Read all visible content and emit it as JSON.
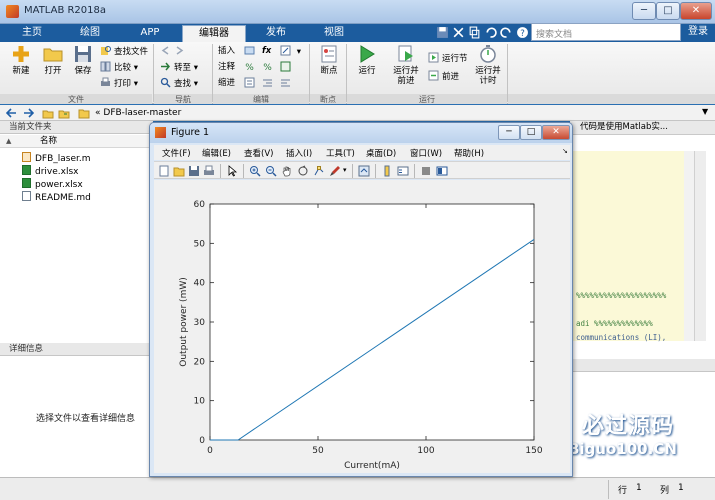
{
  "window": {
    "title": "MATLAB R2018a",
    "minimize": "─",
    "maximize": "□",
    "close": "✕"
  },
  "tabs": [
    {
      "label": "主页"
    },
    {
      "label": "绘图"
    },
    {
      "label": "APP"
    },
    {
      "label": "编辑器",
      "active": true
    },
    {
      "label": "发布"
    },
    {
      "label": "视图"
    }
  ],
  "search": {
    "placeholder": "搜索文档"
  },
  "login_label": "登录",
  "ribbon": {
    "file_group": {
      "label": "文件",
      "new": "新建",
      "open": "打开",
      "save": "保存",
      "find_files": "查找文件",
      "compare": "比较",
      "print": "打印"
    },
    "nav_group": {
      "label": "导航",
      "goto": "转至",
      "find": "查找"
    },
    "edit_group": {
      "label": "编辑",
      "insert": "插入",
      "comment": "注释",
      "indent": "缩进",
      "fx": "fx"
    },
    "breakpoints_group": {
      "label": "断点",
      "breakpoints": "断点"
    },
    "run_group": {
      "label": "运行",
      "run": "运行",
      "run_advance": "运行并\n前进",
      "run_section": "运行节",
      "advance": "前进",
      "run_time": "运行并\n计时"
    }
  },
  "address": {
    "path": "DFB-laser-master",
    "prefix": "«"
  },
  "current_folder": {
    "header": "当前文件夹",
    "column": "名称",
    "sort_indicator": "▲",
    "files": [
      {
        "name": "DFB_laser.m",
        "type": "m"
      },
      {
        "name": "drive.xlsx",
        "type": "xl"
      },
      {
        "name": "power.xlsx",
        "type": "xl"
      },
      {
        "name": "README.md",
        "type": "md"
      }
    ]
  },
  "details": {
    "header": "详细信息",
    "placeholder": "选择文件以查看详细信息"
  },
  "editor": {
    "tab_text": "代码是使用Matlab实...",
    "code_lines": [
      "%%%%%%%%%%%%%%%%%%%%",
      "adi   %%%%%%%%%%%%%",
      "communications (LI),"
    ]
  },
  "status": {
    "row_label": "行",
    "row_value": "1",
    "col_label": "列",
    "col_value": "1"
  },
  "figure": {
    "title": "Figure 1",
    "menu": [
      "文件(F)",
      "编辑(E)",
      "查看(V)",
      "插入(I)",
      "工具(T)",
      "桌面(D)",
      "窗口(W)",
      "帮助(H)"
    ],
    "toolbar_icons": [
      "new-figure-icon",
      "open-icon",
      "save-icon",
      "print-icon",
      "pointer-icon",
      "zoom-in-icon",
      "zoom-out-icon",
      "pan-icon",
      "rotate-icon",
      "data-cursor-icon",
      "brush-icon",
      "link-icon",
      "colorbar-icon",
      "legend-icon",
      "hide-tools-icon",
      "show-tools-icon"
    ]
  },
  "chart_data": {
    "type": "line",
    "title": "",
    "xlabel": "Current(mA)",
    "ylabel": "Output power (mW)",
    "xlim": [
      0,
      150
    ],
    "ylim": [
      0,
      60
    ],
    "xticks": [
      0,
      50,
      100,
      150
    ],
    "yticks": [
      0,
      10,
      20,
      30,
      40,
      50,
      60
    ],
    "grid": false,
    "series": [
      {
        "color": "#1f77b4",
        "x": [
          0,
          13,
          150
        ],
        "y": [
          0,
          0,
          51
        ]
      }
    ]
  },
  "watermark": {
    "main": "必过源码",
    "sub": "Biguo100.CN"
  }
}
